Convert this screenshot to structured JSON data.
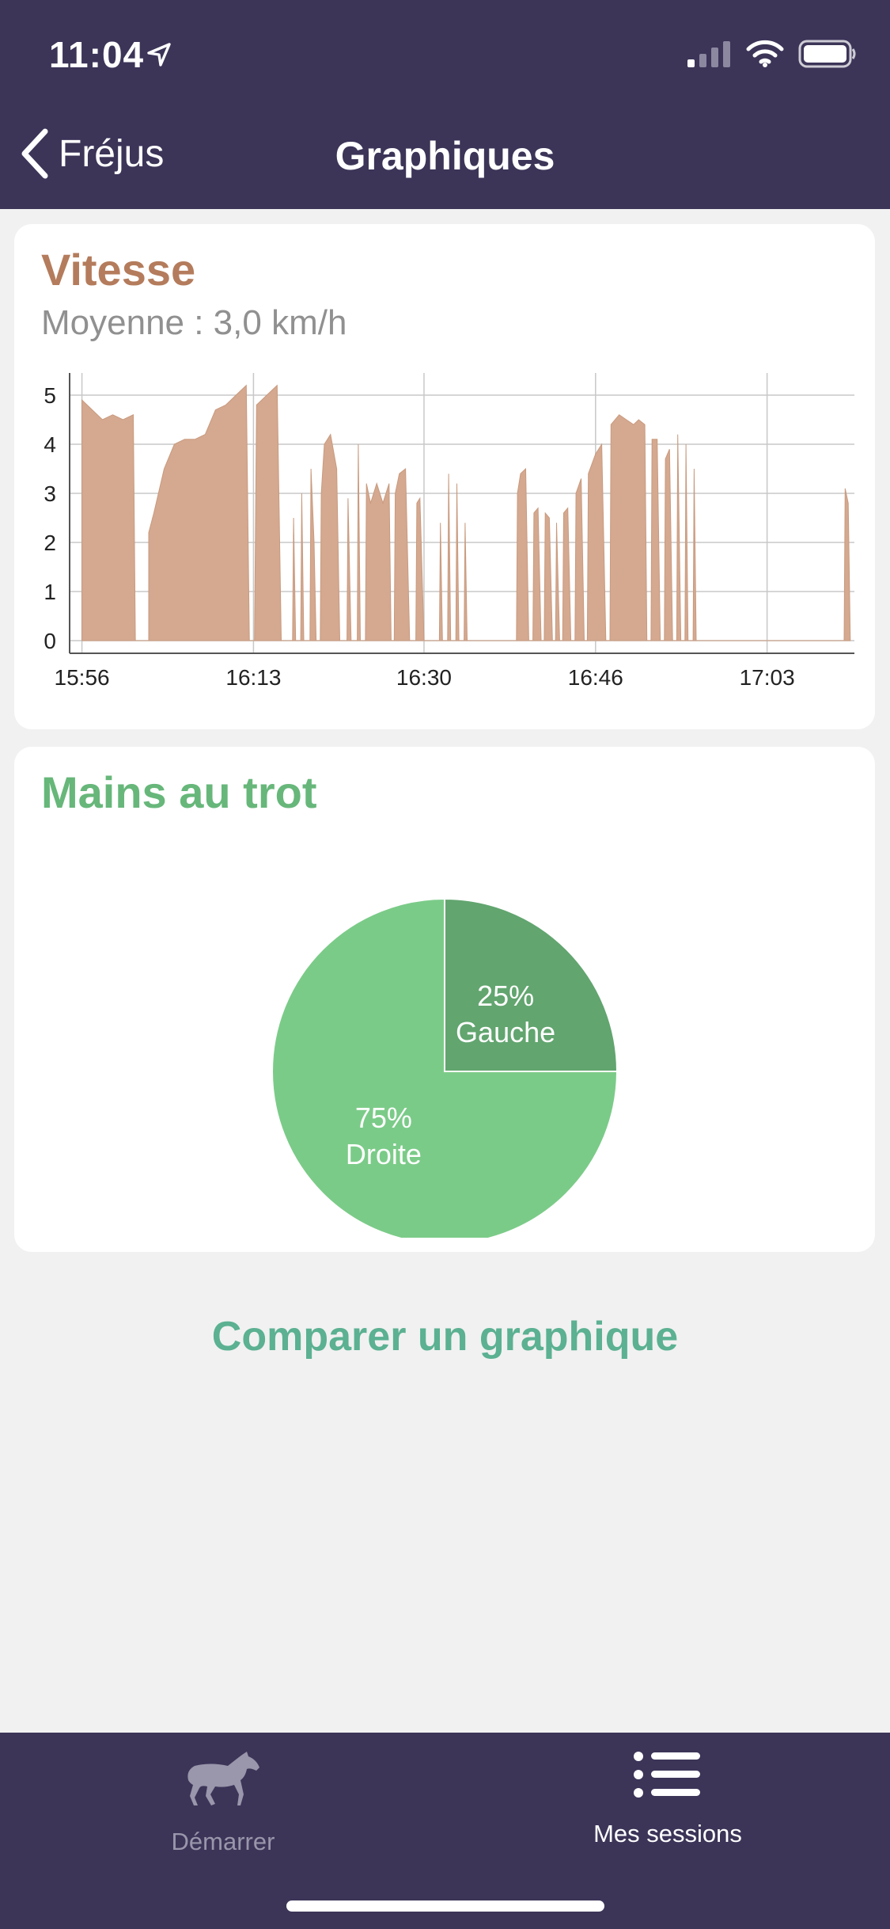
{
  "status_bar": {
    "time": "11:04"
  },
  "nav": {
    "back_label": "Fréjus",
    "title": "Graphiques"
  },
  "speed_card": {
    "title": "Vitesse",
    "subtitle": "Moyenne : 3,0 km/h",
    "chart_data": {
      "type": "area",
      "color": "#d4a990",
      "x_ticks": [
        "15:56",
        "16:13",
        "16:30",
        "16:46",
        "17:03"
      ],
      "y_ticks": [
        "0",
        "1",
        "2",
        "3",
        "4",
        "5"
      ],
      "ylim": [
        0,
        5.5
      ],
      "x_unit": "minutes since 15:56",
      "xlim": [
        -1.2,
        75.2
      ],
      "grid": true,
      "points": [
        [
          0,
          4.9
        ],
        [
          1,
          4.7
        ],
        [
          2,
          4.5
        ],
        [
          3,
          4.6
        ],
        [
          4,
          4.5
        ],
        [
          5,
          4.6
        ],
        [
          5.2,
          0
        ],
        [
          6.5,
          0
        ],
        [
          6.5,
          2.2
        ],
        [
          7,
          2.6
        ],
        [
          8,
          3.5
        ],
        [
          9,
          4.0
        ],
        [
          10,
          4.1
        ],
        [
          11,
          4.1
        ],
        [
          12,
          4.2
        ],
        [
          13,
          4.7
        ],
        [
          14,
          4.8
        ],
        [
          15,
          5.0
        ],
        [
          16,
          5.2
        ],
        [
          16.3,
          0
        ],
        [
          16.8,
          0
        ],
        [
          17,
          4.8
        ],
        [
          18,
          5.0
        ],
        [
          19,
          5.2
        ],
        [
          19.4,
          0
        ],
        [
          20.5,
          0
        ],
        [
          20.6,
          2.5
        ],
        [
          20.8,
          0
        ],
        [
          21.3,
          0
        ],
        [
          21.4,
          3.0
        ],
        [
          21.6,
          0
        ],
        [
          22.2,
          0
        ],
        [
          22.3,
          3.5
        ],
        [
          22.6,
          2.0
        ],
        [
          22.8,
          0
        ],
        [
          23.2,
          0
        ],
        [
          23.3,
          3.0
        ],
        [
          23.6,
          4.0
        ],
        [
          24.2,
          4.2
        ],
        [
          24.8,
          3.5
        ],
        [
          25.1,
          0
        ],
        [
          25.8,
          0
        ],
        [
          25.9,
          2.9
        ],
        [
          26.2,
          0
        ],
        [
          26.8,
          0
        ],
        [
          26.9,
          4.0
        ],
        [
          27.1,
          0
        ],
        [
          27.6,
          0
        ],
        [
          27.7,
          3.2
        ],
        [
          28.1,
          2.8
        ],
        [
          28.7,
          3.2
        ],
        [
          29.3,
          2.8
        ],
        [
          29.9,
          3.2
        ],
        [
          30.1,
          0
        ],
        [
          30.4,
          0
        ],
        [
          30.5,
          3.0
        ],
        [
          30.9,
          3.4
        ],
        [
          31.5,
          3.5
        ],
        [
          31.9,
          0
        ],
        [
          32.5,
          0
        ],
        [
          32.6,
          2.8
        ],
        [
          32.9,
          2.9
        ],
        [
          33.3,
          0
        ],
        [
          34.8,
          0
        ],
        [
          34.9,
          2.4
        ],
        [
          35.1,
          0
        ],
        [
          35.6,
          0
        ],
        [
          35.7,
          3.4
        ],
        [
          35.9,
          0
        ],
        [
          36.4,
          0
        ],
        [
          36.5,
          3.2
        ],
        [
          36.7,
          0
        ],
        [
          37.2,
          0
        ],
        [
          37.3,
          2.4
        ],
        [
          37.5,
          0
        ],
        [
          42.3,
          0
        ],
        [
          42.4,
          3.0
        ],
        [
          42.7,
          3.4
        ],
        [
          43.2,
          3.5
        ],
        [
          43.5,
          0
        ],
        [
          43.9,
          0
        ],
        [
          44.0,
          2.6
        ],
        [
          44.4,
          2.7
        ],
        [
          44.7,
          0
        ],
        [
          45.0,
          0
        ],
        [
          45.1,
          2.6
        ],
        [
          45.5,
          2.5
        ],
        [
          45.8,
          0
        ],
        [
          46.1,
          0
        ],
        [
          46.2,
          2.4
        ],
        [
          46.5,
          0
        ],
        [
          46.8,
          0
        ],
        [
          46.9,
          2.6
        ],
        [
          47.3,
          2.7
        ],
        [
          47.6,
          0
        ],
        [
          48.0,
          0
        ],
        [
          48.1,
          3.0
        ],
        [
          48.6,
          3.3
        ],
        [
          48.9,
          0
        ],
        [
          49.2,
          0
        ],
        [
          49.3,
          3.4
        ],
        [
          50,
          3.8
        ],
        [
          50.6,
          4.0
        ],
        [
          51,
          0
        ],
        [
          51.4,
          0
        ],
        [
          51.5,
          4.4
        ],
        [
          52.3,
          4.6
        ],
        [
          53.0,
          4.5
        ],
        [
          53.7,
          4.4
        ],
        [
          54.2,
          4.5
        ],
        [
          54.8,
          4.4
        ],
        [
          55.0,
          0
        ],
        [
          55.4,
          0
        ],
        [
          55.5,
          4.1
        ],
        [
          56.0,
          4.1
        ],
        [
          56.3,
          0
        ],
        [
          56.7,
          0
        ],
        [
          56.8,
          3.7
        ],
        [
          57.2,
          3.9
        ],
        [
          57.5,
          0
        ],
        [
          57.9,
          0
        ],
        [
          58.0,
          4.2
        ],
        [
          58.3,
          0
        ],
        [
          58.7,
          0
        ],
        [
          58.8,
          4.0
        ],
        [
          59.0,
          0
        ],
        [
          59.5,
          0
        ],
        [
          59.6,
          3.5
        ],
        [
          59.8,
          0
        ],
        [
          74.2,
          0
        ],
        [
          74.3,
          3.1
        ],
        [
          74.6,
          2.8
        ],
        [
          74.8,
          0
        ]
      ]
    }
  },
  "trot_card": {
    "title": "Mains au trot",
    "chart_data": {
      "type": "pie",
      "slices": [
        {
          "label": "Gauche",
          "percent_label": "25%",
          "value": 25,
          "color": "#62a56f"
        },
        {
          "label": "Droite",
          "percent_label": "75%",
          "value": 75,
          "color": "#7bcb88"
        }
      ]
    }
  },
  "compare_label": "Comparer un graphique",
  "tab_bar": {
    "items": [
      {
        "label": "Démarrer",
        "icon": "horse-icon",
        "active": false
      },
      {
        "label": "Mes sessions",
        "icon": "list-icon",
        "active": true
      }
    ]
  }
}
